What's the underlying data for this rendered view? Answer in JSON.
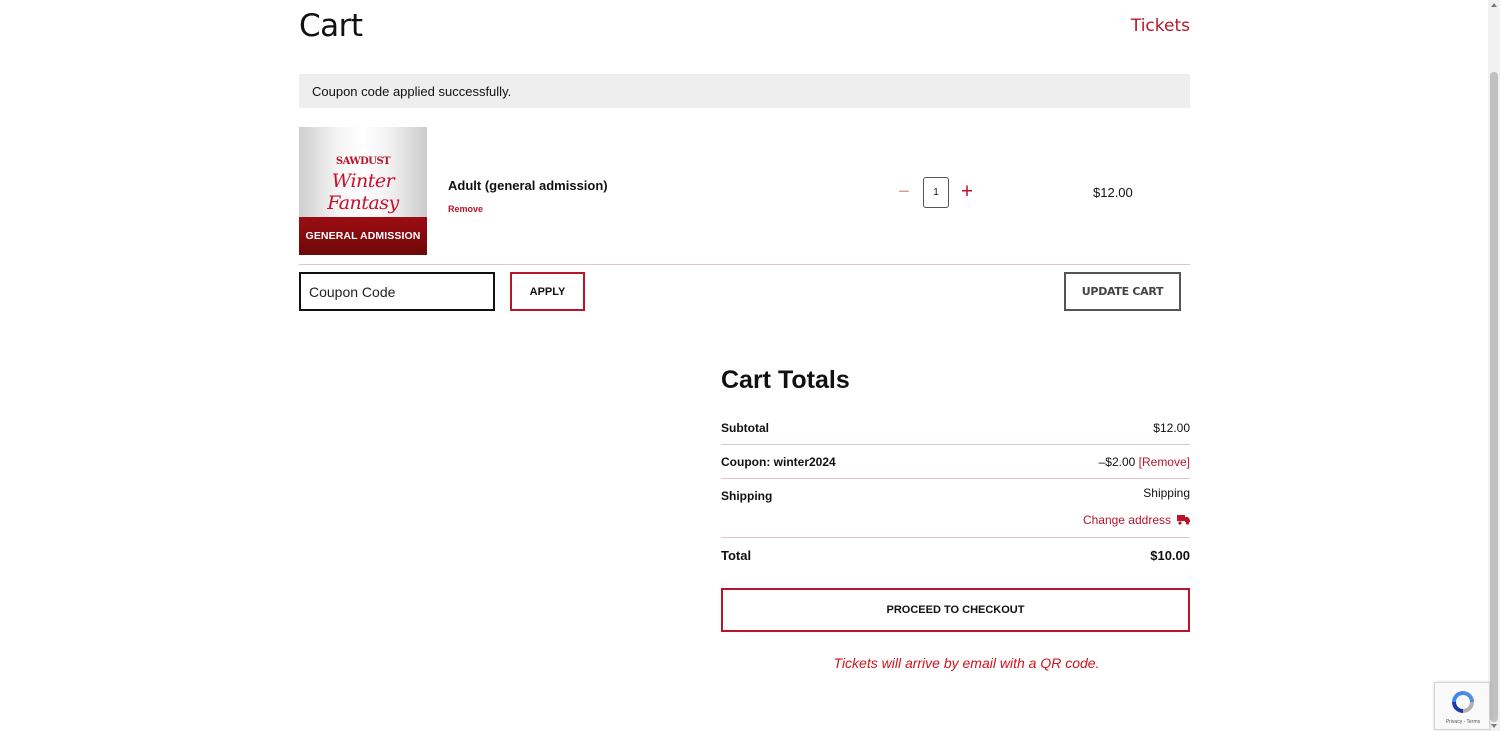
{
  "header": {
    "title": "Cart",
    "tickets_link": "Tickets"
  },
  "notice": {
    "message": "Coupon code applied successfully."
  },
  "cart_item": {
    "image": {
      "brand": "SAWDUST",
      "script_title": "Winter Fantasy",
      "banner": "GENERAL ADMISSION"
    },
    "name": "Adult (general admission)",
    "remove_label": "Remove",
    "quantity": "1",
    "minus_symbol": "−",
    "plus_symbol": "+",
    "price": "$12.00"
  },
  "coupon": {
    "placeholder": "Coupon Code",
    "apply_label": "APPLY"
  },
  "update_cart_label": "UPDATE CART",
  "totals": {
    "title": "Cart Totals",
    "subtotal_label": "Subtotal",
    "subtotal_value": "$12.00",
    "coupon_label": "Coupon: winter2024",
    "coupon_value": "–$2.00",
    "coupon_remove": "[Remove]",
    "shipping_label": "Shipping",
    "shipping_value": "Shipping",
    "change_address": "Change address",
    "total_label": "Total",
    "total_value": "$10.00"
  },
  "checkout_label": "PROCEED TO CHECKOUT",
  "ticket_note": "Tickets will arrive by email with a QR code.",
  "recaptcha": {
    "footer": "Privacy - Terms"
  },
  "colors": {
    "accent": "#b8142b",
    "note_red": "#d0121b",
    "notice_bg": "#eeeeee",
    "divider": "#e3c4c9"
  },
  "icons": [
    "minus-icon",
    "plus-icon",
    "truck-icon",
    "recaptcha-icon"
  ]
}
